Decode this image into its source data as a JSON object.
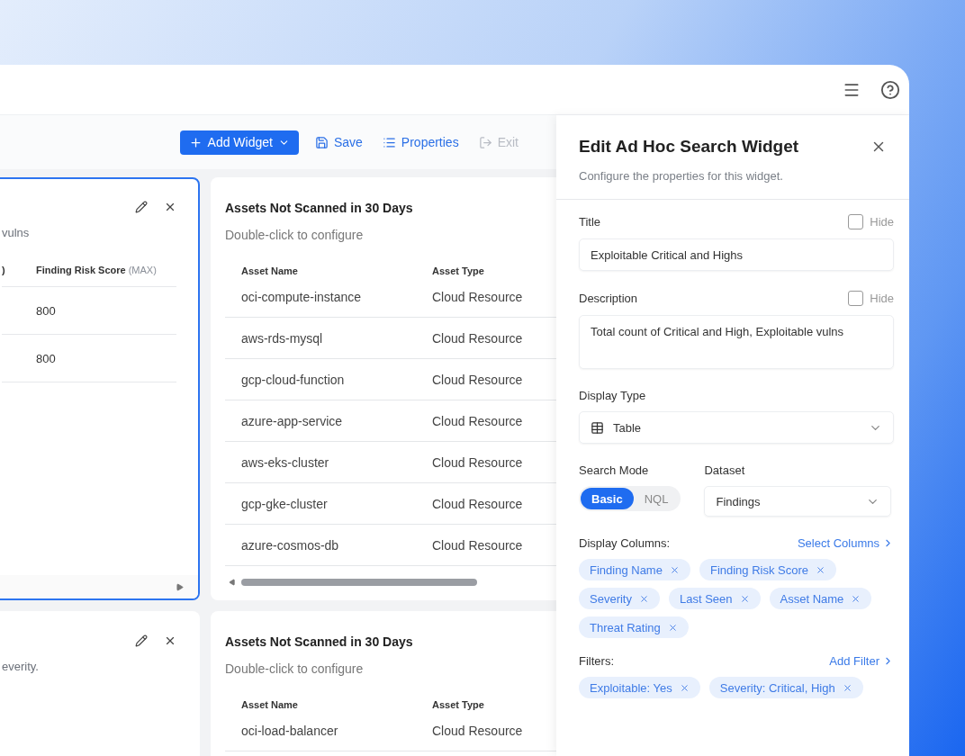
{
  "toolbar": {
    "buttons": [
      {
        "kind": "add",
        "label": "Add Widget",
        "disabled": false
      },
      {
        "kind": "save",
        "label": "Save",
        "disabled": false
      },
      {
        "kind": "properties",
        "label": "Properties",
        "disabled": false
      },
      {
        "kind": "exit",
        "label": "Exit",
        "disabled": true
      }
    ]
  },
  "left_widgets": [
    {
      "selected": true,
      "description": "vulns",
      "columns": [
        {
          "label": ")"
        },
        {
          "label": "Finding Risk Score",
          "aggregate": "(MAX)"
        }
      ],
      "values": [
        "800",
        "800"
      ]
    },
    {
      "selected": false,
      "description": "everity."
    }
  ],
  "middle_widgets": [
    {
      "title": "Assets Not Scanned in 30 Days",
      "hint": "Double-click to configure",
      "columns": [
        "Asset Name",
        "Asset Type"
      ],
      "scrollbar": true,
      "rows": [
        {
          "name": "oci-compute-instance",
          "type": "Cloud Resource"
        },
        {
          "name": "aws-rds-mysql",
          "type": "Cloud Resource"
        },
        {
          "name": "gcp-cloud-function",
          "type": "Cloud Resource"
        },
        {
          "name": "azure-app-service",
          "type": "Cloud Resource"
        },
        {
          "name": "aws-eks-cluster",
          "type": "Cloud Resource"
        },
        {
          "name": "gcp-gke-cluster",
          "type": "Cloud Resource"
        },
        {
          "name": "azure-cosmos-db",
          "type": "Cloud Resource"
        }
      ]
    },
    {
      "title": "Assets Not Scanned in 30 Days",
      "hint": "Double-click to configure",
      "columns": [
        "Asset Name",
        "Asset Type"
      ],
      "rows": [
        {
          "name": "oci-load-balancer",
          "type": "Cloud Resource"
        }
      ]
    }
  ],
  "panel": {
    "title": "Edit Ad Hoc Search Widget",
    "subtitle": "Configure the properties for this widget.",
    "title_field": {
      "label": "Title",
      "hide_label": "Hide",
      "hide": false,
      "value": "Exploitable Critical and Highs"
    },
    "description_field": {
      "label": "Description",
      "hide_label": "Hide",
      "hide": false,
      "value": "Total count of Critical and High, Exploitable vulns"
    },
    "display_type": {
      "label": "Display Type",
      "value": "Table"
    },
    "search_mode": {
      "label": "Search Mode",
      "options": [
        {
          "label": "Basic",
          "selected": true
        },
        {
          "label": "NQL",
          "selected": false
        }
      ]
    },
    "dataset": {
      "label": "Dataset",
      "value": "Findings"
    },
    "display_columns": {
      "label": "Display Columns:",
      "link": "Select Columns",
      "chips": [
        "Finding Name",
        "Finding Risk Score",
        "Severity",
        "Last Seen",
        "Asset Name",
        "Threat Rating"
      ]
    },
    "filters": {
      "label": "Filters:",
      "link": "Add Filter",
      "chips": [
        "Exploitable: Yes",
        "Severity: Critical, High"
      ]
    }
  }
}
